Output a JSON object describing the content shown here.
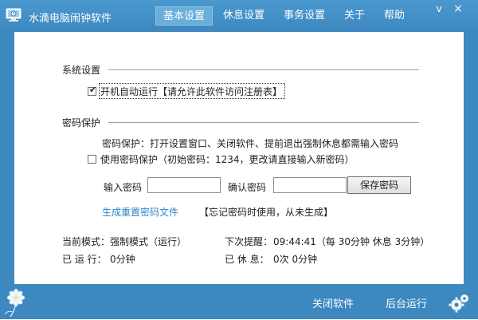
{
  "app": {
    "title": "水滴电脑闹钟软件"
  },
  "tabs": [
    {
      "label": "基本设置",
      "active": true
    },
    {
      "label": "休息设置",
      "active": false
    },
    {
      "label": "事务设置",
      "active": false
    },
    {
      "label": "关于",
      "active": false
    },
    {
      "label": "帮助",
      "active": false
    }
  ],
  "window_controls": {
    "minimize": "v",
    "close": "×"
  },
  "system_settings": {
    "title": "系统设置",
    "autostart_label": "开机自动运行【请允许此软件访问注册表】",
    "autostart_checked": true
  },
  "password_protection": {
    "title": "密码保护",
    "description": "密码保护：打开设置窗口、关闭软件、提前退出强制休息都需输入密码",
    "use_password_label": "使用密码保护（初始密码：1234，更改请直接输入新密码）",
    "use_password_checked": false,
    "input_password_label": "输入密码",
    "input_password_value": "",
    "confirm_password_label": "确认密码",
    "confirm_password_value": "",
    "save_button": "保存密码",
    "reset_link": "生成重置密码文件",
    "reset_note": "【忘记密码时使用，从未生成】"
  },
  "status": {
    "mode_label": "当前模式：",
    "mode_value": "强制模式（运行）",
    "next_reminder_label": "下次提醒：",
    "next_reminder_value": "09:44:41（每 30分钟 休息 3分钟）",
    "running_label": "已 运 行：",
    "running_value": "0分钟",
    "rested_label": "已 休 息：",
    "rested_value": "0次  0分钟"
  },
  "footer": {
    "close_app": "关闭软件",
    "background_run": "后台运行"
  },
  "colors": {
    "frame": "#3c88bf",
    "active_tab": "#6aaedb",
    "link": "#2e86c7"
  },
  "icons": {
    "app": "monitor-clock-icon",
    "flower": "flower-icon",
    "settings": "gears-icon"
  }
}
